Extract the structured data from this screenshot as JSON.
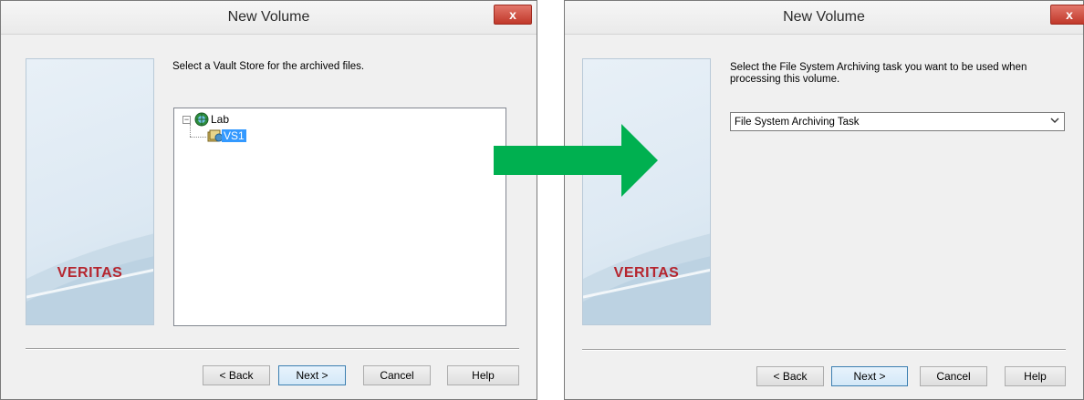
{
  "left_dialog": {
    "title": "New Volume",
    "close_label": "x",
    "logo": "VERITAS",
    "prompt": "Select a Vault Store for the archived files.",
    "tree": {
      "root_expander": "⊟",
      "root_label": "Lab",
      "child_label": "VS1"
    },
    "buttons": {
      "back": "< Back",
      "next": "Next >",
      "cancel": "Cancel",
      "help": "Help"
    }
  },
  "right_dialog": {
    "title": "New Volume",
    "close_label": "x",
    "logo": "VERITAS",
    "prompt": "Select the File System Archiving task you want to be used when processing this volume.",
    "select_value": "File System Archiving Task",
    "select_chevron": "⌄",
    "buttons": {
      "back": "< Back",
      "next": "Next >",
      "cancel": "Cancel",
      "help": "Help"
    }
  },
  "colors": {
    "arrow": "#00b050",
    "selection": "#3399ff",
    "logo": "#b5262f"
  }
}
